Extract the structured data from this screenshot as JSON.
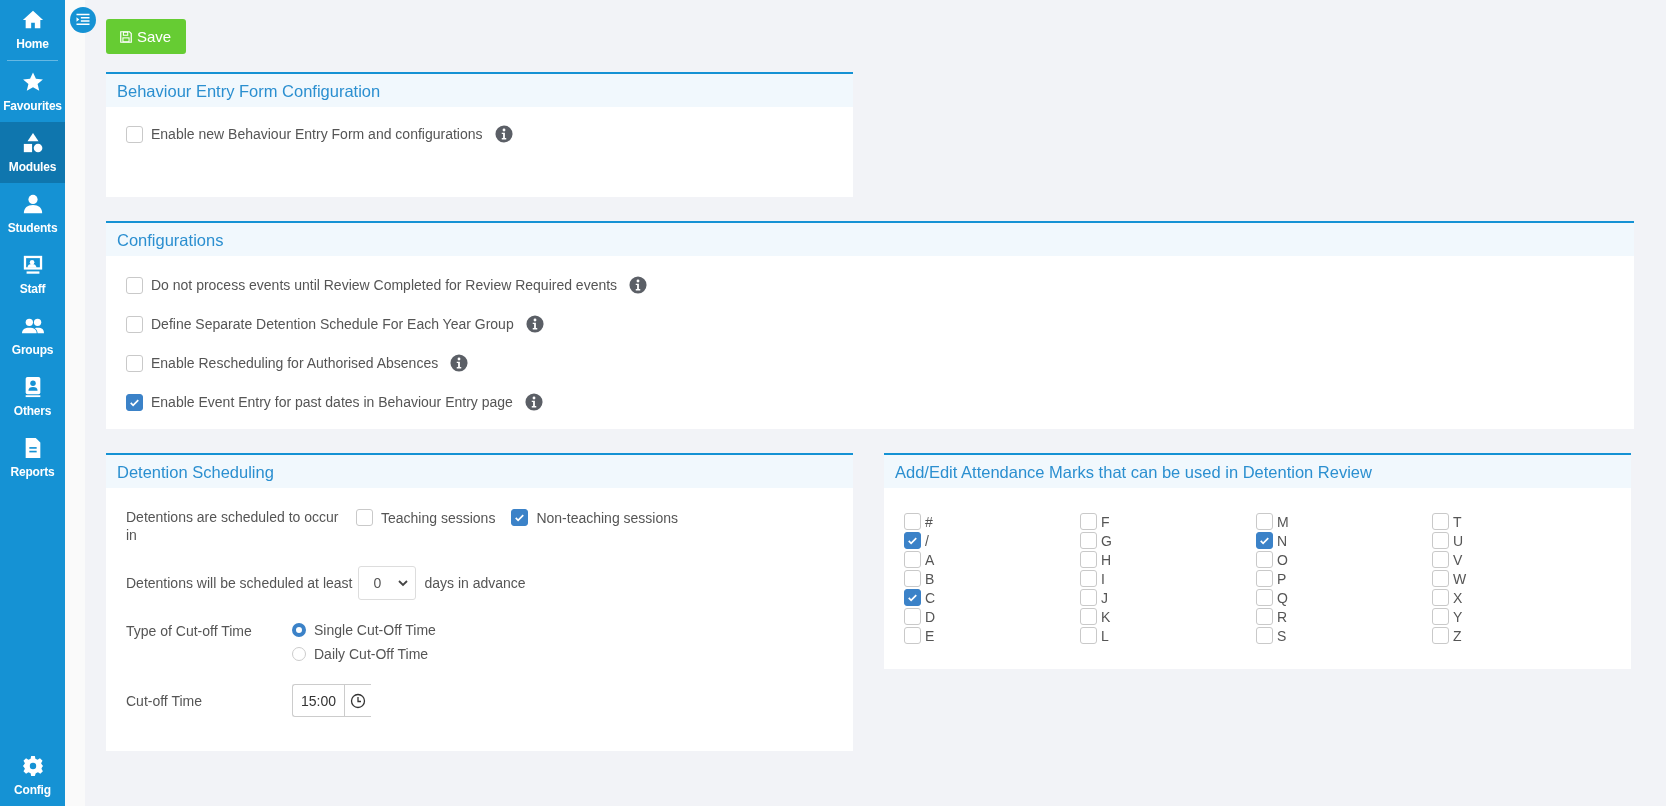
{
  "sidebar": {
    "items": [
      {
        "label": "Home",
        "selected": false
      },
      {
        "label": "Favourites",
        "selected": false
      },
      {
        "label": "Modules",
        "selected": true
      },
      {
        "label": "Students",
        "selected": false
      },
      {
        "label": "Staff",
        "selected": false
      },
      {
        "label": "Groups",
        "selected": false
      },
      {
        "label": "Others",
        "selected": false
      },
      {
        "label": "Reports",
        "selected": false
      }
    ],
    "bottom_item": {
      "label": "Config",
      "selected": false
    }
  },
  "save_button": {
    "label": "Save"
  },
  "behaviour_entry_form": {
    "title": "Behaviour Entry Form Configuration",
    "options": [
      {
        "label": "Enable new Behaviour Entry Form and configurations",
        "checked": false,
        "info": true
      }
    ]
  },
  "configurations": {
    "title": "Configurations",
    "options": [
      {
        "label": "Do not process events until Review Completed for Review Required events",
        "checked": false,
        "info": true
      },
      {
        "label": "Define Separate Detention Schedule For Each Year Group",
        "checked": false,
        "info": true
      },
      {
        "label": "Enable Rescheduling for Authorised Absences",
        "checked": false,
        "info": true
      },
      {
        "label": "Enable Event Entry for past dates in Behaviour Entry page",
        "checked": true,
        "info": true
      }
    ]
  },
  "detention_scheduling": {
    "title": "Detention Scheduling",
    "occur": {
      "label": "Detentions are scheduled to occur in",
      "options": [
        {
          "label": "Teaching sessions",
          "checked": false
        },
        {
          "label": "Non-teaching sessions",
          "checked": true
        }
      ]
    },
    "advance": {
      "label": "Detentions will be scheduled at least",
      "value": "0",
      "suffix": "days in advance"
    },
    "cutoff_type": {
      "label": "Type of Cut-off Time",
      "options": [
        {
          "label": "Single Cut-Off Time",
          "selected": true
        },
        {
          "label": "Daily Cut-Off Time",
          "selected": false
        }
      ]
    },
    "cutoff_time": {
      "label": "Cut-off Time",
      "value": "15:00"
    }
  },
  "attendance_marks": {
    "title": "Add/Edit Attendance Marks that can be used in Detention Review",
    "marks": [
      {
        "label": "#",
        "checked": false
      },
      {
        "label": "/",
        "checked": true
      },
      {
        "label": "A",
        "checked": false
      },
      {
        "label": "B",
        "checked": false
      },
      {
        "label": "C",
        "checked": true
      },
      {
        "label": "D",
        "checked": false
      },
      {
        "label": "E",
        "checked": false
      },
      {
        "label": "F",
        "checked": false
      },
      {
        "label": "G",
        "checked": false
      },
      {
        "label": "H",
        "checked": false
      },
      {
        "label": "I",
        "checked": false
      },
      {
        "label": "J",
        "checked": false
      },
      {
        "label": "K",
        "checked": false
      },
      {
        "label": "L",
        "checked": false
      },
      {
        "label": "M",
        "checked": false
      },
      {
        "label": "N",
        "checked": true
      },
      {
        "label": "O",
        "checked": false
      },
      {
        "label": "P",
        "checked": false
      },
      {
        "label": "Q",
        "checked": false
      },
      {
        "label": "R",
        "checked": false
      },
      {
        "label": "S",
        "checked": false
      },
      {
        "label": "T",
        "checked": false
      },
      {
        "label": "U",
        "checked": false
      },
      {
        "label": "V",
        "checked": false
      },
      {
        "label": "W",
        "checked": false
      },
      {
        "label": "X",
        "checked": false
      },
      {
        "label": "Y",
        "checked": false
      },
      {
        "label": "Z",
        "checked": false
      }
    ]
  }
}
